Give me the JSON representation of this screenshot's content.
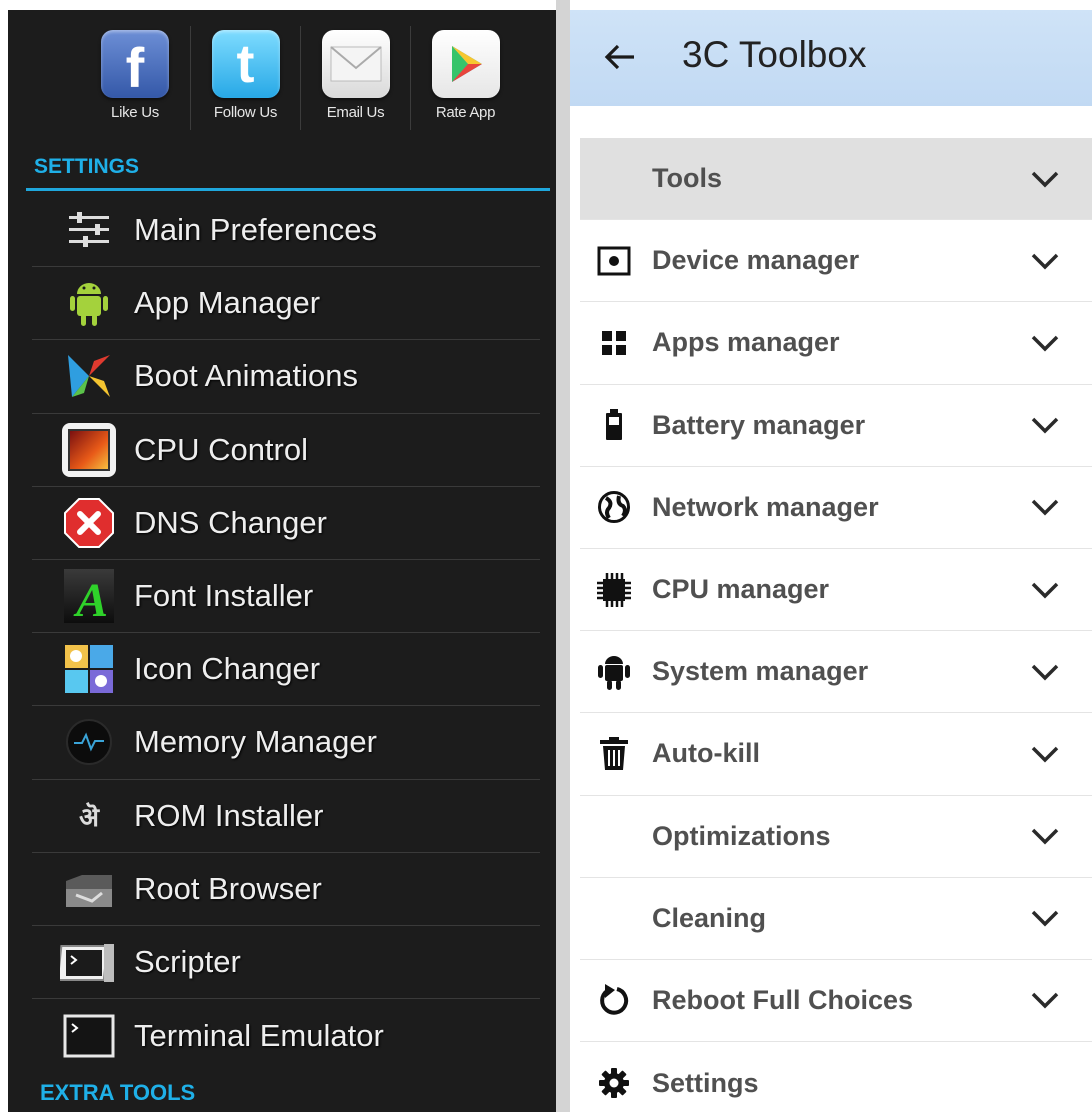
{
  "left_panel": {
    "social": [
      {
        "label": "Like Us",
        "icon": "facebook-icon"
      },
      {
        "label": "Follow Us",
        "icon": "twitter-icon"
      },
      {
        "label": "Email Us",
        "icon": "email-icon"
      },
      {
        "label": "Rate App",
        "icon": "play-store-icon"
      }
    ],
    "settings_header": "SETTINGS",
    "menu": [
      {
        "label": "Main Preferences",
        "icon": "sliders-icon"
      },
      {
        "label": "App Manager",
        "icon": "android-icon"
      },
      {
        "label": "Boot Animations",
        "icon": "boot-animation-icon"
      },
      {
        "label": "CPU Control",
        "icon": "cpu-control-icon"
      },
      {
        "label": "DNS Changer",
        "icon": "dns-changer-icon"
      },
      {
        "label": "Font Installer",
        "icon": "font-installer-icon"
      },
      {
        "label": "Icon Changer",
        "icon": "icon-changer-icon"
      },
      {
        "label": "Memory Manager",
        "icon": "memory-manager-icon"
      },
      {
        "label": "ROM Installer",
        "icon": "rom-installer-icon"
      },
      {
        "label": "Root Browser",
        "icon": "root-browser-icon"
      },
      {
        "label": "Scripter",
        "icon": "scripter-icon"
      },
      {
        "label": "Terminal Emulator",
        "icon": "terminal-icon"
      }
    ],
    "extra_header": "EXTRA TOOLS",
    "colors": {
      "background": "#1c1c1c",
      "accent": "#1fb0e8"
    }
  },
  "right_panel": {
    "title": "3C Toolbox",
    "rows": [
      {
        "label": "Tools",
        "icon": "",
        "expandable": true,
        "active": true
      },
      {
        "label": "Device manager",
        "icon": "device-icon",
        "expandable": true
      },
      {
        "label": "Apps manager",
        "icon": "apps-grid-icon",
        "expandable": true
      },
      {
        "label": "Battery manager",
        "icon": "battery-icon",
        "expandable": true
      },
      {
        "label": "Network manager",
        "icon": "globe-icon",
        "expandable": true
      },
      {
        "label": "CPU manager",
        "icon": "chip-icon",
        "expandable": true
      },
      {
        "label": "System manager",
        "icon": "android-icon",
        "expandable": true
      },
      {
        "label": "Auto-kill",
        "icon": "trash-icon",
        "expandable": true
      },
      {
        "label": "Optimizations",
        "icon": "",
        "expandable": true
      },
      {
        "label": "Cleaning",
        "icon": "",
        "expandable": true
      },
      {
        "label": "Reboot Full Choices",
        "icon": "reboot-icon",
        "expandable": true
      },
      {
        "label": "Settings",
        "icon": "gear-icon",
        "expandable": false
      }
    ],
    "colors": {
      "appbar": "#c8ddf5",
      "active_row": "#e0e0e0"
    }
  }
}
